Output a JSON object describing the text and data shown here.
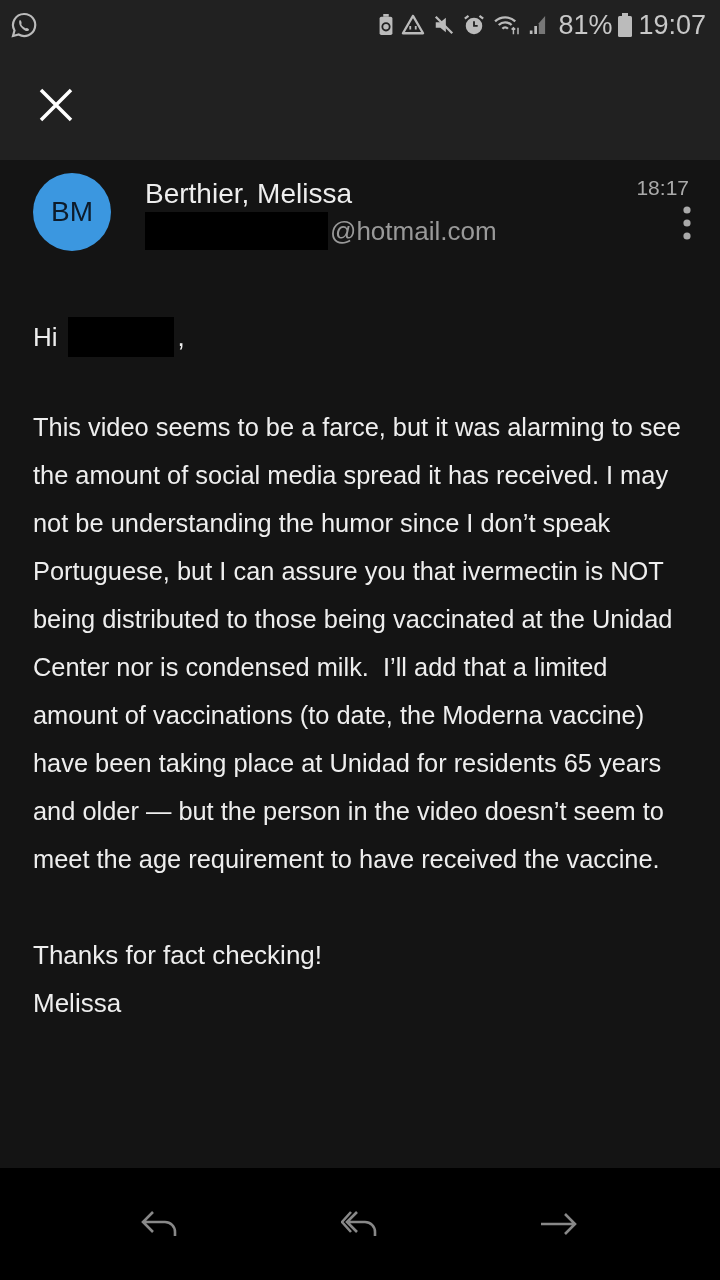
{
  "status_bar": {
    "battery": "81%",
    "time": "19:07"
  },
  "message": {
    "avatar_initials": "BM",
    "sender": "Berthier, Melissa",
    "email_domain": "@hotmail.com",
    "time": "18:17",
    "greeting": "Hi",
    "greeting_end": ",",
    "body": "This video seems to be a farce, but it was alarming to see the amount of social media spread it has received. I may not be understanding the humor since I don’t speak Portuguese, but I can assure you that ivermectin is NOT being distributed to those being vaccinated at the Unidad Center nor is condensed milk.  I’ll add that a limited amount of vaccinations (to date, the Moderna vaccine) have been taking place at Unidad for residents 65 years and older — but the person in the video doesn’t seem to meet the age requirement to have received the vaccine.",
    "signoff": [
      "Thanks for fact checking!",
      "Melissa"
    ]
  }
}
